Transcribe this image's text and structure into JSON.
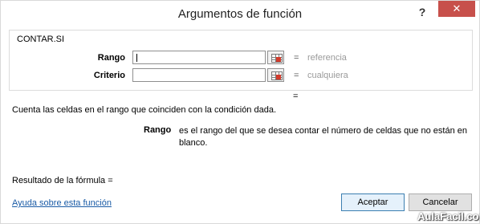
{
  "window": {
    "title": "Argumentos de función",
    "help_label": "?",
    "close_label": "✕"
  },
  "function": {
    "name": "CONTAR.SI",
    "args": [
      {
        "label": "Rango",
        "value": "",
        "equals": "=",
        "hint": "referencia"
      },
      {
        "label": "Criterio",
        "value": "",
        "equals": "=",
        "hint": "cualquiera"
      }
    ],
    "result_equals": "=",
    "description": "Cuenta las celdas en el rango que coinciden con la condición dada.",
    "current_arg_name": "Rango",
    "current_arg_description": "es el rango del que se desea contar el número de celdas que no están en blanco."
  },
  "footer": {
    "result_label": "Resultado de la fórmula =",
    "help_link": "Ayuda sobre esta función",
    "ok_label": "Aceptar",
    "cancel_label": "Cancelar"
  },
  "watermark": "AulaFacil.com",
  "colors": {
    "close_bg": "#c7504b",
    "link": "#1a5ba6",
    "primary_border": "#3c7fb1"
  }
}
